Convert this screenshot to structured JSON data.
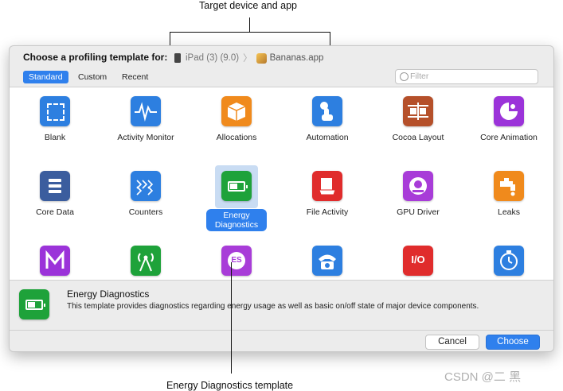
{
  "annotations": {
    "top": "Target device and app",
    "bottom": "Energy Diagnostics template"
  },
  "titlebar": {
    "prompt": "Choose a profiling template for:",
    "device": "iPad (3) (9.0)",
    "separator": "〉",
    "app": "Bananas.app"
  },
  "tabs": [
    "Standard",
    "Custom",
    "Recent"
  ],
  "filter": {
    "placeholder": "Filter"
  },
  "templates": [
    {
      "label": "Blank",
      "color": "#2d7fe0",
      "icon": "blank-icon"
    },
    {
      "label": "Activity Monitor",
      "color": "#2d7fe0",
      "icon": "activity-monitor-icon"
    },
    {
      "label": "Allocations",
      "color": "#f08a1c",
      "icon": "allocations-icon"
    },
    {
      "label": "Automation",
      "color": "#2d7fe0",
      "icon": "automation-icon"
    },
    {
      "label": "Cocoa Layout",
      "color": "#b5502a",
      "icon": "cocoa-layout-icon"
    },
    {
      "label": "Core Animation",
      "color": "#9b33d9",
      "icon": "core-animation-icon"
    },
    {
      "label": "Core Data",
      "color": "#3b5d9e",
      "icon": "core-data-icon"
    },
    {
      "label": "Counters",
      "color": "#2d7fe0",
      "icon": "counters-icon"
    },
    {
      "label": "Energy Diagnostics",
      "color": "#1ea23a",
      "icon": "energy-diagnostics-icon"
    },
    {
      "label": "File Activity",
      "color": "#e02c2c",
      "icon": "file-activity-icon"
    },
    {
      "label": "GPU Driver",
      "color": "#a83cd8",
      "icon": "gpu-driver-icon"
    },
    {
      "label": "Leaks",
      "color": "#f08a1c",
      "icon": "leaks-icon"
    },
    {
      "label": "",
      "color": "#9b33d9",
      "icon": "metal-icon"
    },
    {
      "label": "",
      "color": "#1ea23a",
      "icon": "network-icon"
    },
    {
      "label": "",
      "color": "#a83cd8",
      "icon": "opengl-es-icon"
    },
    {
      "label": "",
      "color": "#2d7fe0",
      "icon": "system-usage-icon"
    },
    {
      "label": "",
      "color": "#e02c2c",
      "icon": "io-icon"
    },
    {
      "label": "",
      "color": "#2d7fe0",
      "icon": "time-profiler-icon"
    }
  ],
  "selected": {
    "name": "Energy Diagnostics",
    "description": "This template provides diagnostics regarding energy usage as well as basic on/off state of major device components."
  },
  "buttons": {
    "cancel": "Cancel",
    "choose": "Choose"
  },
  "watermark": "CSDN @二 黑"
}
